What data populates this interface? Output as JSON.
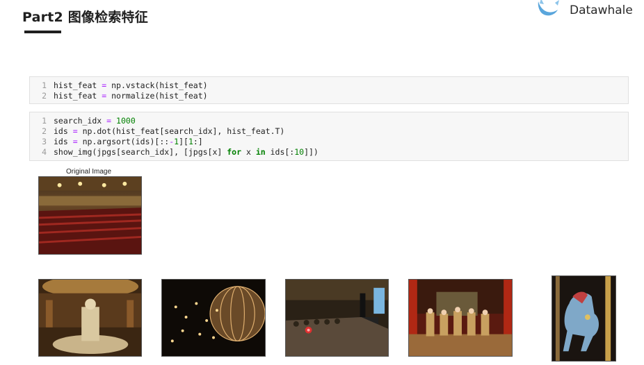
{
  "slide": {
    "title": "Part2 图像检索特征",
    "brand": "Datawhale"
  },
  "cells": {
    "cell1": {
      "lines": [
        {
          "n": "1",
          "code": "hist_feat = np.vstack(hist_feat)"
        },
        {
          "n": "2",
          "code": "hist_feat = normalize(hist_feat)"
        }
      ]
    },
    "cell2": {
      "lines": [
        {
          "n": "1",
          "code": "search_idx = 1000"
        },
        {
          "n": "2",
          "code": "ids = np.dot(hist_feat[search_idx], hist_feat.T)"
        },
        {
          "n": "3",
          "code": "ids = np.argsort(ids)[::-1][1:]"
        },
        {
          "n": "4",
          "code": "show_img(jpgs[search_idx], [jpgs[x] for x in ids[:10]])"
        }
      ]
    }
  },
  "output": {
    "original_caption": "Original Image",
    "results": [
      "casino-fountain-hall",
      "chandelier-sphere",
      "conference-stage-audience",
      "stage-performers",
      "carousel-horse"
    ]
  },
  "colors": {
    "keyword": "#008000",
    "number": "#008000",
    "operator": "#aa22ff"
  }
}
